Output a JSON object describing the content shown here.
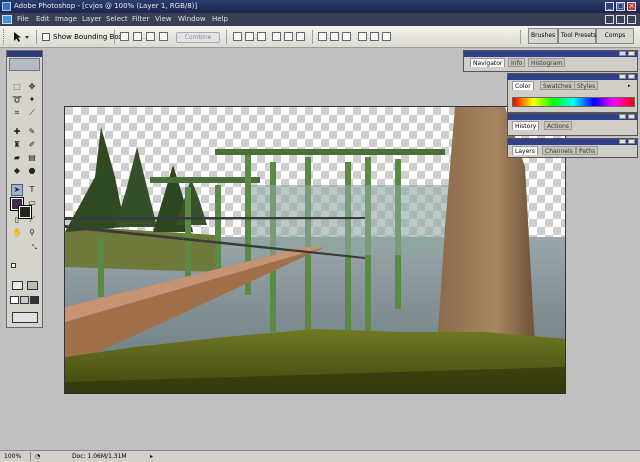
{
  "window": {
    "title": "Adobe Photoshop - [cvjos @ 100% (Layer 1, RGB/8)]",
    "controls": [
      "_",
      "□",
      "×"
    ]
  },
  "menu": [
    "File",
    "Edit",
    "Image",
    "Layer",
    "Select",
    "Filter",
    "View",
    "Window",
    "Help"
  ],
  "options": {
    "show_bounding_box": "Show Bounding Box",
    "combine": "Combine",
    "wells": [
      "Brushes",
      "Tool Presets",
      "Comps"
    ]
  },
  "panels": {
    "navigator": {
      "tabs": [
        "Navigator",
        "Info",
        "Histogram"
      ],
      "active": 0
    },
    "color": {
      "tabs": [
        "Color",
        "Swatches",
        "Styles"
      ],
      "active": 0
    },
    "history": {
      "tabs": [
        "History",
        "Actions"
      ],
      "active": 0
    },
    "layers": {
      "tabs": [
        "Layers",
        "Channels",
        "Paths"
      ],
      "active": 0
    }
  },
  "colors": {
    "foreground": "#3c2d56",
    "background": "#222a1c",
    "title_bar": "#1c2650",
    "panel_header": "#30408a"
  },
  "status": {
    "zoom": "100%",
    "doc": "Doc: 1.06M/1.31M"
  }
}
